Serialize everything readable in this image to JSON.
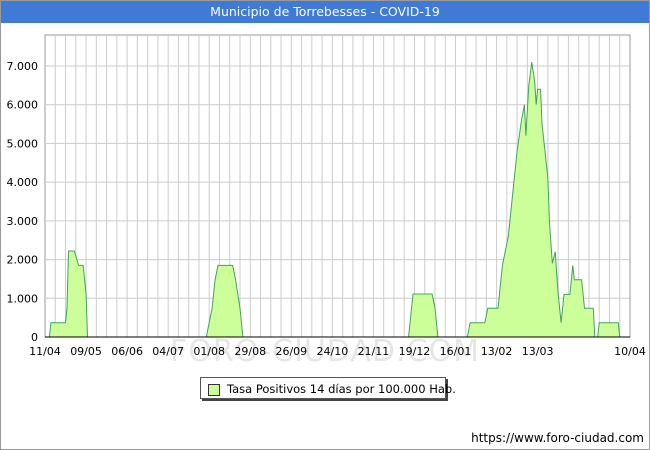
{
  "header": {
    "title": "Municipio de Torrebesses - COVID-19"
  },
  "footer": {
    "source": "https://www.foro-ciudad.com"
  },
  "watermark": {
    "text": "FORO-CIUDAD.COM"
  },
  "colors": {
    "title_bar": "#3f7ad6",
    "fill": "#ccff99",
    "line": "#44a060",
    "grid": "#cccccc"
  },
  "chart_data": {
    "type": "area",
    "title": "Municipio de Torrebesses - COVID-19",
    "x_ticks": [
      "11/04",
      "09/05",
      "06/06",
      "04/07",
      "01/08",
      "29/08",
      "26/09",
      "24/10",
      "21/11",
      "19/12",
      "16/01",
      "13/02",
      "13/03",
      "10/04"
    ],
    "y_ticks": [
      "0",
      "1.000",
      "2.000",
      "3.000",
      "4.000",
      "5.000",
      "6.000",
      "7.000"
    ],
    "ylim": [
      0,
      7800
    ],
    "grid": true,
    "legend_position": "bottom-center",
    "series": [
      {
        "name": "Tasa Positivos 14 días por 100.000 Hab.",
        "points": [
          [
            0,
            0
          ],
          [
            3,
            0
          ],
          [
            4,
            370
          ],
          [
            14,
            370
          ],
          [
            15,
            740
          ],
          [
            16,
            2220
          ],
          [
            20,
            2220
          ],
          [
            23,
            1850
          ],
          [
            26,
            1850
          ],
          [
            28,
            1110
          ],
          [
            29,
            0
          ],
          [
            110,
            0
          ],
          [
            114,
            740
          ],
          [
            116,
            1480
          ],
          [
            118,
            1850
          ],
          [
            128,
            1850
          ],
          [
            130,
            1480
          ],
          [
            133,
            740
          ],
          [
            135,
            0
          ],
          [
            248,
            0
          ],
          [
            250,
            740
          ],
          [
            251,
            1110
          ],
          [
            264,
            1110
          ],
          [
            266,
            740
          ],
          [
            268,
            0
          ],
          [
            288,
            0
          ],
          [
            290,
            370
          ],
          [
            300,
            370
          ],
          [
            302,
            740
          ],
          [
            309,
            740
          ],
          [
            312,
            1850
          ],
          [
            316,
            2600
          ],
          [
            319,
            3700
          ],
          [
            322,
            4800
          ],
          [
            325,
            5600
          ],
          [
            327,
            6000
          ],
          [
            328,
            5200
          ],
          [
            330,
            6500
          ],
          [
            332,
            7100
          ],
          [
            334,
            6600
          ],
          [
            335,
            6000
          ],
          [
            336,
            6400
          ],
          [
            338,
            6400
          ],
          [
            339,
            5500
          ],
          [
            341,
            4800
          ],
          [
            343,
            4100
          ],
          [
            344,
            3000
          ],
          [
            346,
            1900
          ],
          [
            348,
            2200
          ],
          [
            350,
            1100
          ],
          [
            352,
            370
          ],
          [
            354,
            1100
          ],
          [
            358,
            1100
          ],
          [
            360,
            1850
          ],
          [
            361,
            1480
          ],
          [
            366,
            1480
          ],
          [
            368,
            740
          ],
          [
            374,
            740
          ],
          [
            375,
            0
          ],
          [
            377,
            0
          ],
          [
            378,
            370
          ],
          [
            391,
            370
          ],
          [
            392,
            0
          ]
        ]
      }
    ]
  },
  "legend": {
    "label": "Tasa Positivos 14 días por 100.000 Hab."
  }
}
